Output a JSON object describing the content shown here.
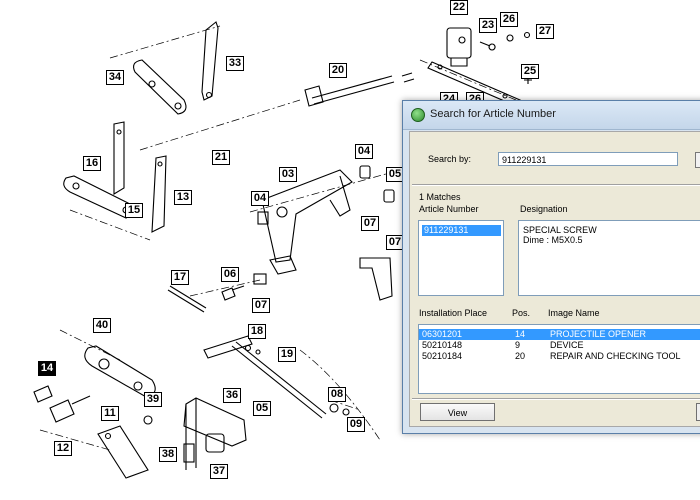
{
  "drawing": {
    "callouts": [
      "22",
      "23",
      "26",
      "27",
      "33",
      "34",
      "20",
      "25",
      "24",
      "26",
      "21",
      "16",
      "15",
      "13",
      "03",
      "04",
      "04",
      "05",
      "07",
      "07",
      "06",
      "17",
      "07",
      "40",
      "18",
      "19",
      "14",
      "39",
      "36",
      "05",
      "11",
      "12",
      "38",
      "37",
      "08",
      "09"
    ]
  },
  "dialog": {
    "title": "Search for Article Number",
    "search_label": "Search by:",
    "search_value": "911229131",
    "matches_label": "1 Matches",
    "article_header": "Article Number",
    "designation_header": "Designation",
    "article_items": [
      "911229131"
    ],
    "designation_lines": [
      "SPECIAL SCREW",
      "Dime : M5X0.5"
    ],
    "install_headers": {
      "place": "Installation Place",
      "pos": "Pos.",
      "image": "Image Name"
    },
    "install_rows": [
      {
        "place": "06301201",
        "pos": "14",
        "image": "PROJECTILE OPENER",
        "selected": true
      },
      {
        "place": "50210148",
        "pos": "9",
        "image": "DEVICE",
        "selected": false
      },
      {
        "place": "50210184",
        "pos": "20",
        "image": "REPAIR AND CHECKING TOOL",
        "selected": false
      }
    ],
    "view_label": "View"
  }
}
